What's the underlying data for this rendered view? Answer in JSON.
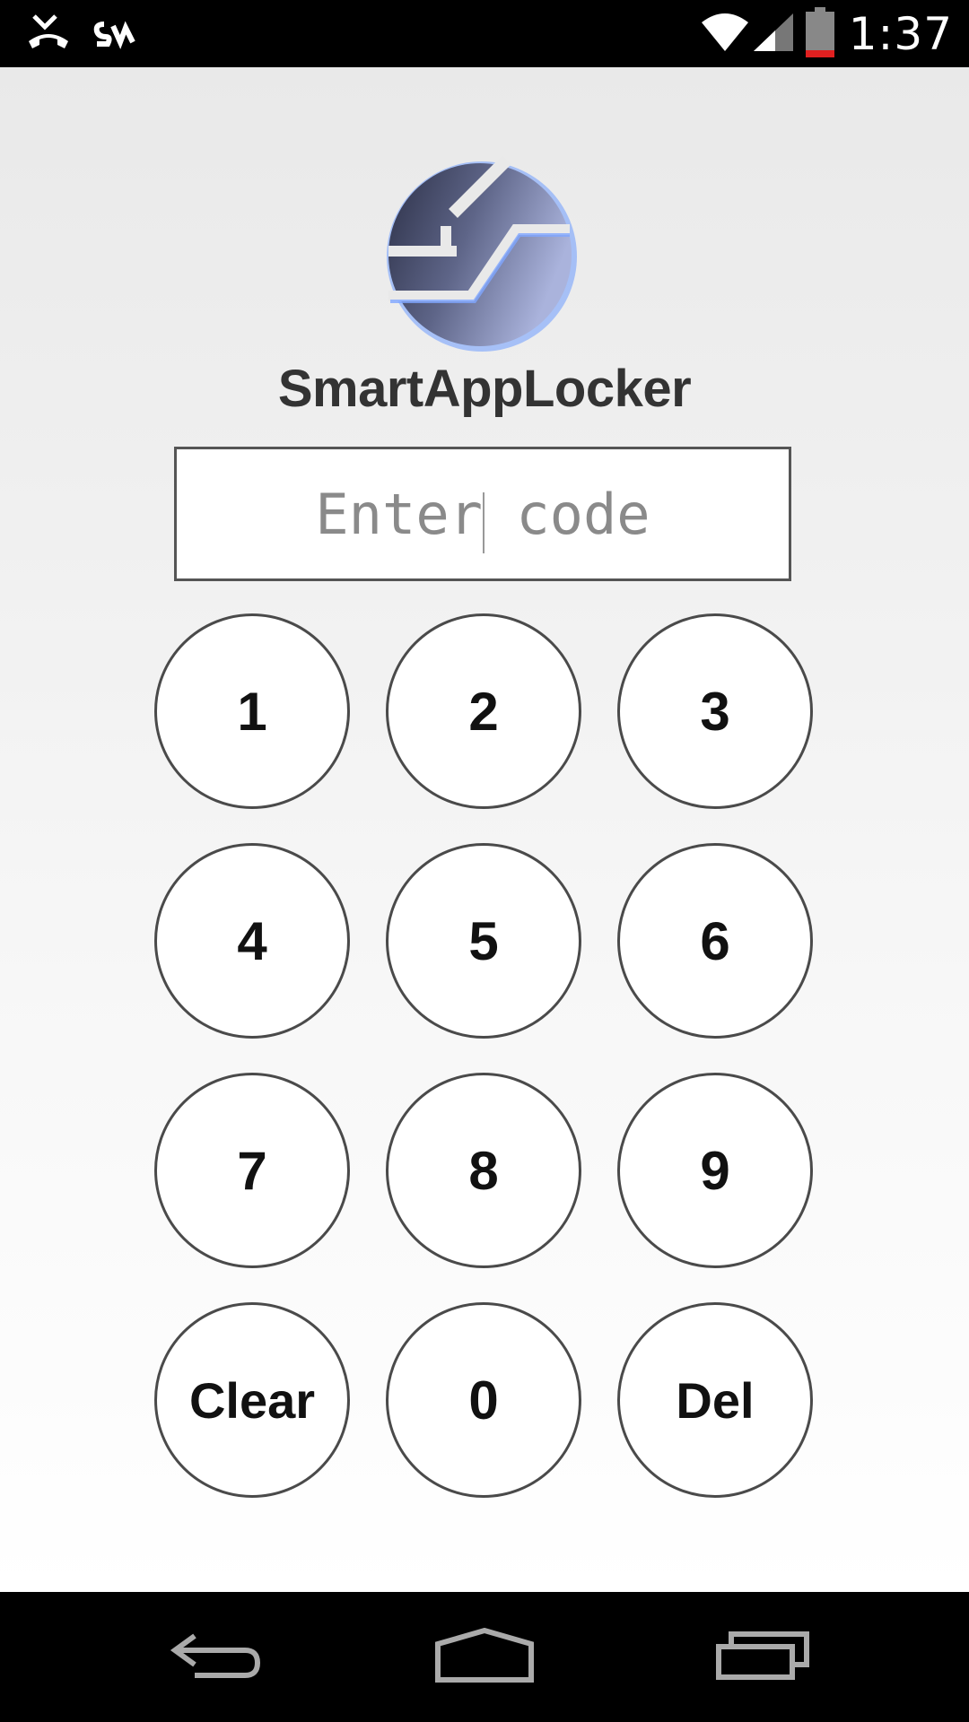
{
  "status_bar": {
    "time": "1:37",
    "icons": [
      "missed-call-icon",
      "sync-icon",
      "wifi-icon",
      "signal-icon",
      "battery-icon"
    ],
    "battery_level": 0.1
  },
  "app": {
    "title": "SmartAppLocker",
    "logo_icon": "smartapplocker-logo-icon"
  },
  "code_input": {
    "placeholder": "Enter code",
    "value": ""
  },
  "keypad": {
    "keys": [
      "1",
      "2",
      "3",
      "4",
      "5",
      "6",
      "7",
      "8",
      "9",
      "Clear",
      "0",
      "Del"
    ]
  },
  "nav_bar": {
    "icons": [
      "back-icon",
      "home-icon",
      "recents-icon"
    ]
  },
  "colors": {
    "logo_gradient_start": "#2c3047",
    "logo_gradient_end": "#aab3dc",
    "logo_glow": "#6b9bff",
    "key_border": "#4a4a4a"
  }
}
